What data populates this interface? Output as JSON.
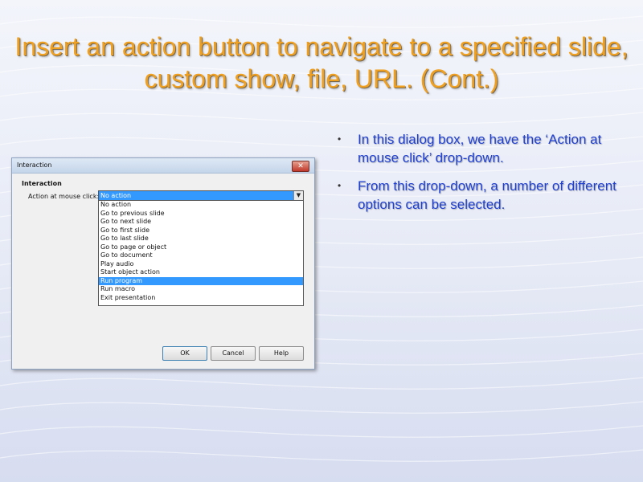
{
  "slide": {
    "title": "Insert an action button to navigate to a specified slide, custom show, file, URL. (Cont.)",
    "bullets": [
      "In this dialog box, we have the ‘Action at mouse click’ drop-down.",
      "From this drop-down, a number of different options can be selected."
    ],
    "bullet_glyph": "•"
  },
  "dialog": {
    "title": "Interaction",
    "close_glyph": "✕",
    "section_label": "Interaction",
    "field_label": "Action at mouse click:",
    "combo_value": "No action",
    "combo_arrow": "▼",
    "options": [
      {
        "label": "No action",
        "selected": false
      },
      {
        "label": "Go to previous slide",
        "selected": false
      },
      {
        "label": "Go to next slide",
        "selected": false
      },
      {
        "label": "Go to first slide",
        "selected": false
      },
      {
        "label": "Go to last slide",
        "selected": false
      },
      {
        "label": "Go to page or object",
        "selected": false
      },
      {
        "label": "Go to document",
        "selected": false
      },
      {
        "label": "Play audio",
        "selected": false
      },
      {
        "label": "Start object action",
        "selected": false
      },
      {
        "label": "Run program",
        "selected": true
      },
      {
        "label": "Run macro",
        "selected": false
      },
      {
        "label": "Exit presentation",
        "selected": false
      }
    ],
    "buttons": {
      "ok": "OK",
      "cancel": "Cancel",
      "help": "Help"
    }
  },
  "colors": {
    "title": "#f0a020",
    "bullet_text": "#1f3fd1",
    "selection": "#3399ff"
  }
}
